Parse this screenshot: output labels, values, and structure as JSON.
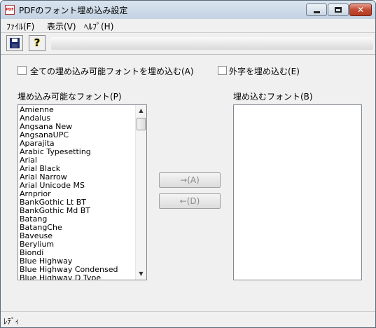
{
  "window": {
    "title": "PDFのフォント埋め込み設定",
    "icon_glyph": "PDF",
    "close_glyph": "✕"
  },
  "menu": {
    "file": "ﾌｧｲﾙ(F)",
    "view": "表示(V)",
    "help": "ﾍﾙﾌﾟ(H)"
  },
  "toolbar": {
    "save_icon": "floppy-disk-icon",
    "help_glyph": "?"
  },
  "options": {
    "embed_all_label": "全ての埋め込み可能フォントを埋め込む(A)",
    "embed_all_checked": false,
    "embed_gaiji_label": "外字を埋め込む(E)",
    "embed_gaiji_checked": false
  },
  "available": {
    "heading": "埋め込み可能なフォント(P)",
    "fonts": [
      "Amienne",
      "Andalus",
      "Angsana New",
      "AngsanaUPC",
      "Aparajita",
      "Arabic Typesetting",
      "Arial",
      "Arial Black",
      "Arial Narrow",
      "Arial Unicode MS",
      "Arnprior",
      "BankGothic Lt BT",
      "BankGothic Md BT",
      "Batang",
      "BatangChe",
      "Baveuse",
      "Berylium",
      "Biondi",
      "Blue Highway",
      "Blue Highway Condensed",
      "Blue Highway D Type"
    ]
  },
  "embedded": {
    "heading": "埋め込むフォント(B)",
    "fonts": []
  },
  "buttons": {
    "add_label": "→(A)",
    "remove_label": "←(D)"
  },
  "status": {
    "text": "ﾚﾃﾞｨ"
  }
}
